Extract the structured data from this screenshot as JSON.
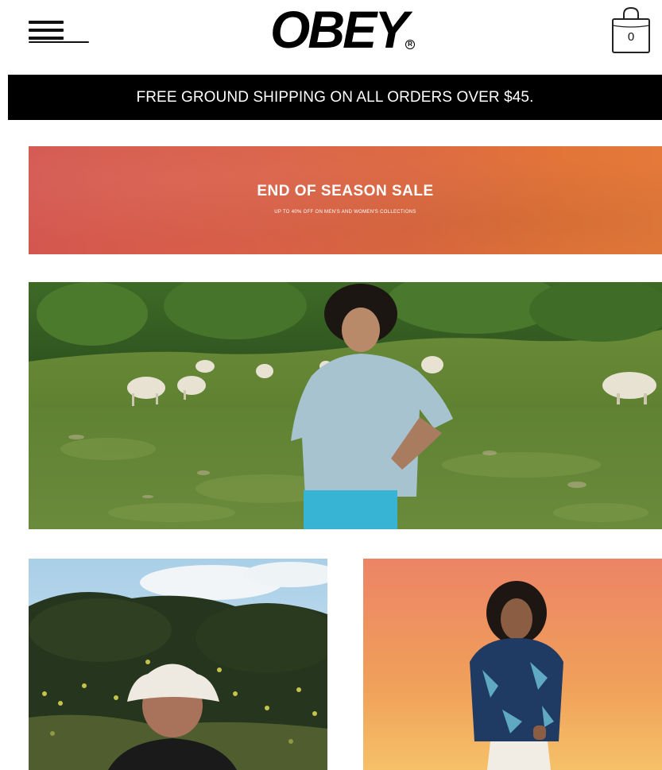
{
  "header": {
    "logo_text": "OBEY",
    "logo_mark": "R",
    "cart_count": "0",
    "menu_icon": "hamburger-menu-icon",
    "cart_icon": "shopping-bag-icon"
  },
  "promo_bar": {
    "text": "FREE GROUND SHIPPING ON ALL ORDERS OVER $45."
  },
  "sale_banner": {
    "title": "END OF SEASON SALE",
    "subtitle": "UP TO 40% OFF ON MEN'S AND WOMEN'S COLLECTIONS"
  },
  "colors": {
    "promo_bg": "#000000",
    "promo_text": "#ffffff",
    "sale_gradient_start": "#d4574f",
    "sale_gradient_end": "#e4793a"
  }
}
